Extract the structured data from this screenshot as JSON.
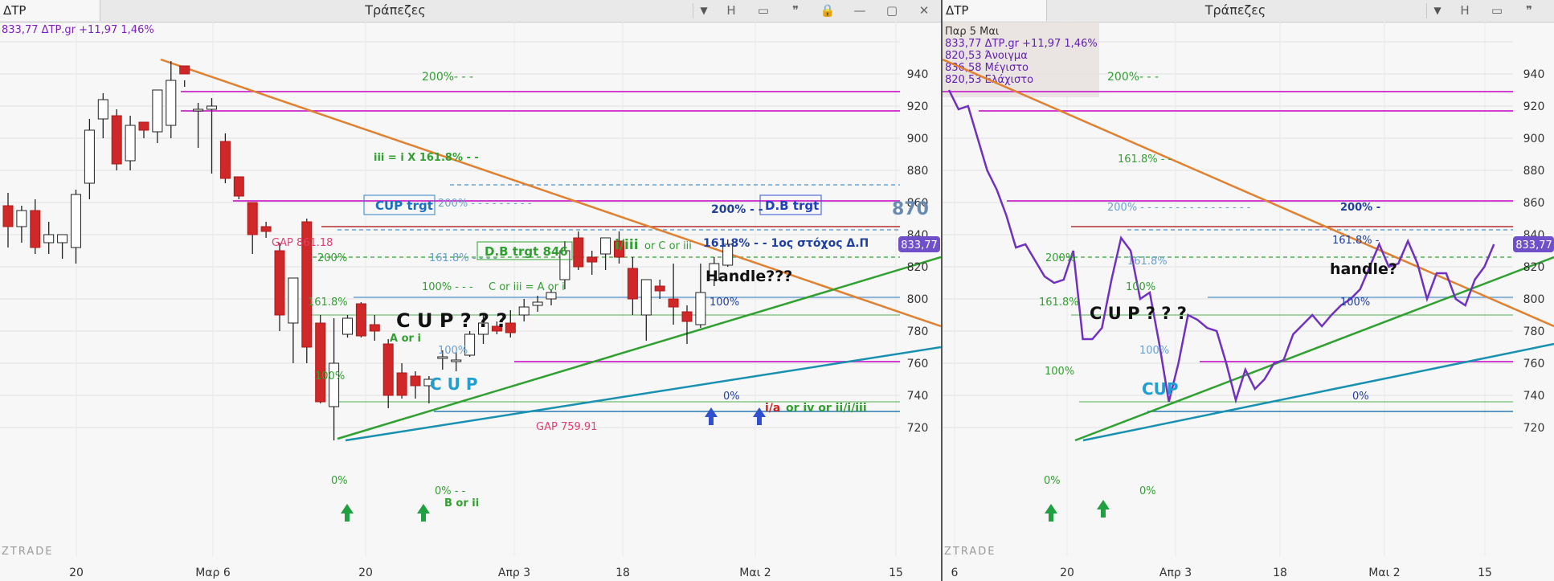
{
  "left": {
    "symbol": "ΔΤΡ",
    "title": "Τράπεζες",
    "header_line": "833,77 ΔΤΡ.gr +11,97 1,46%",
    "last_price_tag": "833,77",
    "watermark": "ZTRADE",
    "buttons": [
      "H",
      "▭",
      "❞",
      "🔒",
      "—",
      "▢",
      "✕"
    ],
    "x_ticks": [
      "20",
      "Μαρ 6",
      "20",
      "Απρ 3",
      "18",
      "Μαι 2",
      "15"
    ],
    "y_ticks": [
      "940",
      "920",
      "900",
      "880",
      "860",
      "840",
      "820",
      "800",
      "780",
      "760",
      "740",
      "720"
    ],
    "annotations": {
      "cup_q": "C U P ? ? ?",
      "cup": "C U P",
      "handle": "Handle???",
      "cup_target": "CUP trgt",
      "db_target": "D.B trgt",
      "db_target_846": "D.B trgt 846",
      "big_870": "870",
      "gap_861": "GAP 861.18",
      "gap_759": "GAP 759.91",
      "iii_ix": "iii = i X 161.8%",
      "c_or_iii": "C or iii = A or i",
      "a_or_i": "A or i",
      "b_or_ii": "B or ii",
      "i_iii_c": "i/iii",
      "or_c_or_iii": "or C or iii",
      "target_greek": "161.8% - - 1ος  στόχος Δ.Π",
      "ia_wave": "i/a",
      "ia_rest": "or iv or ii/i/iii",
      "p200_a": "200%",
      "p200_b": "200%",
      "p200_c": "200%",
      "p200_d": "200%",
      "p1618_a": "161.8%",
      "p1618_b": "161.8%",
      "p100_a": "100%",
      "p100_b": "100%",
      "p100_c": "100%",
      "p100_d": "100%",
      "p0_a": "0%",
      "p0_b": "0%",
      "p0_c": "0%"
    }
  },
  "right": {
    "symbol": "ΔΤΡ",
    "title": "Τράπεζες",
    "info": [
      "Παρ 5 Μαι",
      "833,77 ΔΤΡ.gr +11,97 1,46%",
      "820,53 Άνοιγμα",
      "836,58 Μέγιστο",
      "820,53 Ελάχιστο"
    ],
    "last_price_tag": "833,77",
    "watermark": "ZTRADE",
    "buttons": [
      "H",
      "▭",
      "❞",
      "🔒",
      "—",
      "▢",
      "✕"
    ],
    "x_ticks": [
      "6",
      "20",
      "Απρ 3",
      "18",
      "Μαι 2",
      "15"
    ],
    "y_ticks": [
      "940",
      "920",
      "900",
      "880",
      "860",
      "840",
      "820",
      "800",
      "780",
      "760",
      "740",
      "720"
    ],
    "annotations": {
      "cup_q": "C U P ? ? ?",
      "cup": "CUP",
      "handle": "handle?",
      "p200_a": "200%",
      "p200_b": "200%",
      "p200_c": "200%",
      "p200_d": "200%",
      "p1618_a": "161.8%",
      "p1618_b": "161.8%",
      "p1618_c": "161.8%",
      "p1618_d": "161.8%",
      "p100_a": "100%",
      "p100_b": "100%",
      "p100_c": "100%",
      "p100_d": "100%",
      "p0_a": "0%",
      "p0_b": "0%",
      "p0_c": "0%"
    }
  },
  "chart_data": [
    {
      "type": "candlestick",
      "title": "Τράπεζες",
      "series_label": "ΔΤΡ.gr",
      "ylim": [
        712,
        950
      ],
      "x_index_labels": {
        "0": "20",
        "10": "Μαρ 6",
        "20": "20",
        "28": "Απρ 3",
        "37": "18",
        "47": "Μαι 2",
        "56": "15"
      },
      "candles": [
        [
          0,
          858,
          866,
          832,
          845
        ],
        [
          1,
          845,
          858,
          835,
          855
        ],
        [
          2,
          855,
          862,
          828,
          832
        ],
        [
          3,
          835,
          848,
          828,
          840
        ],
        [
          4,
          835,
          840,
          825,
          840
        ],
        [
          5,
          832,
          868,
          822,
          865
        ],
        [
          6,
          872,
          912,
          862,
          905
        ],
        [
          7,
          912,
          928,
          900,
          924
        ],
        [
          8,
          914,
          918,
          880,
          884
        ],
        [
          9,
          886,
          914,
          880,
          908
        ],
        [
          10,
          910,
          908,
          900,
          905
        ],
        [
          11,
          904,
          926,
          897,
          930
        ],
        [
          12,
          908,
          948,
          900,
          936
        ],
        [
          13,
          945,
          936,
          932,
          940
        ],
        [
          14,
          918,
          922,
          894,
          918
        ],
        [
          15,
          918,
          925,
          878,
          920
        ],
        [
          16,
          898,
          903,
          872,
          875
        ],
        [
          17,
          876,
          872,
          862,
          864
        ],
        [
          18,
          860,
          852,
          828,
          840
        ],
        [
          19,
          845,
          848,
          838,
          842
        ],
        [
          20,
          830,
          835,
          780,
          790
        ],
        [
          21,
          785,
          812,
          760,
          813
        ],
        [
          22,
          848,
          850,
          760,
          770
        ],
        [
          23,
          785,
          790,
          735,
          736
        ],
        [
          24,
          733,
          788,
          712,
          760
        ],
        [
          25,
          778,
          790,
          776,
          788
        ],
        [
          26,
          797,
          798,
          776,
          777
        ],
        [
          27,
          784,
          790,
          774,
          780
        ],
        [
          28,
          772,
          775,
          732,
          740
        ],
        [
          29,
          754,
          760,
          738,
          740
        ],
        [
          30,
          752,
          755,
          738,
          746
        ],
        [
          31,
          746,
          752,
          735,
          750
        ],
        [
          32,
          763,
          768,
          756,
          764
        ],
        [
          33,
          762,
          767,
          755,
          762
        ],
        [
          34,
          765,
          780,
          764,
          778
        ],
        [
          35,
          778,
          790,
          772,
          785
        ],
        [
          36,
          783,
          786,
          778,
          780
        ],
        [
          37,
          785,
          793,
          776,
          779
        ],
        [
          38,
          790,
          800,
          786,
          795
        ],
        [
          39,
          796,
          802,
          792,
          798
        ],
        [
          40,
          800,
          806,
          796,
          804
        ],
        [
          41,
          812,
          836,
          806,
          830
        ],
        [
          42,
          838,
          842,
          818,
          820
        ],
        [
          43,
          826,
          830,
          815,
          823
        ],
        [
          44,
          828,
          838,
          818,
          838
        ],
        [
          45,
          836,
          842,
          822,
          826
        ],
        [
          46,
          819,
          826,
          790,
          800
        ],
        [
          47,
          790,
          812,
          774,
          812
        ],
        [
          48,
          808,
          812,
          800,
          805
        ],
        [
          49,
          800,
          822,
          784,
          795
        ],
        [
          50,
          792,
          796,
          772,
          786
        ],
        [
          51,
          784,
          822,
          782,
          804
        ],
        [
          52,
          812,
          826,
          808,
          822
        ],
        [
          53,
          821,
          837,
          820,
          834
        ]
      ]
    },
    {
      "type": "line",
      "title": "Τράπεζες",
      "series": [
        {
          "name": "ΔΤΡ.gr",
          "color": "#7030c0",
          "values": [
            [
              0,
              930
            ],
            [
              1,
              918
            ],
            [
              2,
              920
            ],
            [
              3,
              900
            ],
            [
              4,
              880
            ],
            [
              5,
              868
            ],
            [
              6,
              852
            ],
            [
              7,
              832
            ],
            [
              8,
              834
            ],
            [
              9,
              824
            ],
            [
              10,
              814
            ],
            [
              11,
              810
            ],
            [
              12,
              812
            ],
            [
              13,
              830
            ],
            [
              14,
              775
            ],
            [
              15,
              775
            ],
            [
              16,
              782
            ],
            [
              17,
              812
            ],
            [
              18,
              838
            ],
            [
              19,
              830
            ],
            [
              20,
              800
            ],
            [
              21,
              804
            ],
            [
              22,
              772
            ],
            [
              23,
              736
            ],
            [
              24,
              760
            ],
            [
              25,
              790
            ],
            [
              26,
              787
            ],
            [
              27,
              782
            ],
            [
              28,
              780
            ],
            [
              29,
              760
            ],
            [
              30,
              737
            ],
            [
              31,
              756
            ],
            [
              32,
              744
            ],
            [
              33,
              750
            ],
            [
              34,
              760
            ],
            [
              35,
              762
            ],
            [
              36,
              778
            ],
            [
              37,
              784
            ],
            [
              38,
              790
            ],
            [
              39,
              783
            ],
            [
              40,
              790
            ],
            [
              41,
              796
            ],
            [
              42,
              800
            ],
            [
              43,
              806
            ],
            [
              44,
              820
            ],
            [
              45,
              834
            ],
            [
              46,
              820
            ],
            [
              47,
              822
            ],
            [
              48,
              836
            ],
            [
              49,
              822
            ],
            [
              50,
              800
            ],
            [
              51,
              816
            ],
            [
              52,
              816
            ],
            [
              53,
              800
            ],
            [
              54,
              796
            ],
            [
              55,
              812
            ],
            [
              56,
              820
            ],
            [
              57,
              834
            ]
          ]
        }
      ],
      "ylim": [
        712,
        950
      ]
    }
  ]
}
